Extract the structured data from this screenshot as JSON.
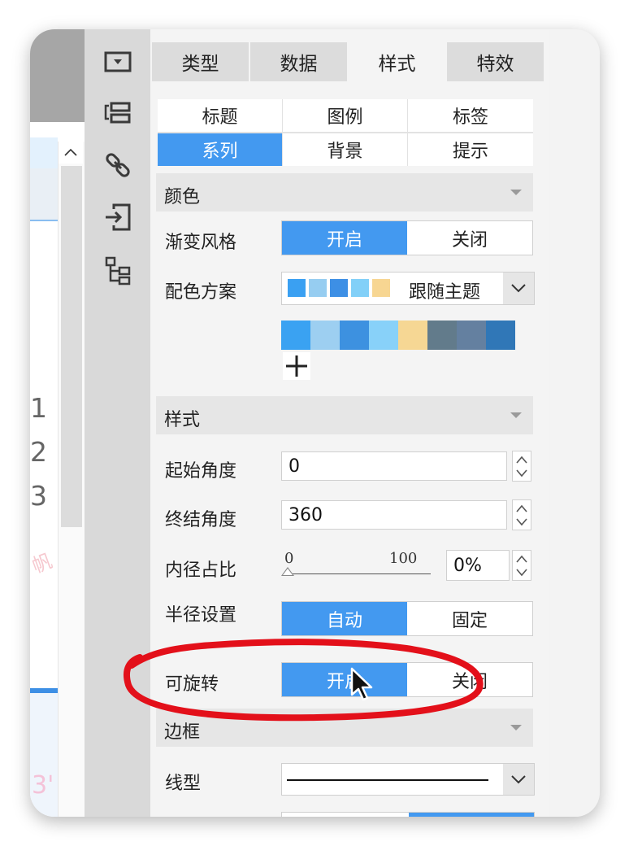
{
  "canvas": {
    "row_numbers": [
      "1",
      "2",
      "3"
    ],
    "ghost_text_1": "帆",
    "ghost_text_2": "3'"
  },
  "toolbar_icons": [
    "screen-icon",
    "layers-icon",
    "link-icon",
    "import-icon",
    "tree-icon"
  ],
  "tabs": [
    {
      "label": "类型",
      "active": false
    },
    {
      "label": "数据",
      "active": false
    },
    {
      "label": "样式",
      "active": true
    },
    {
      "label": "特效",
      "active": false
    }
  ],
  "subtabs": [
    {
      "label": "标题",
      "active": false
    },
    {
      "label": "图例",
      "active": false
    },
    {
      "label": "标签",
      "active": false
    },
    {
      "label": "系列",
      "active": true
    },
    {
      "label": "背景",
      "active": false
    },
    {
      "label": "提示",
      "active": false
    }
  ],
  "color_section": {
    "title": "颜色",
    "gradient": {
      "label": "渐变风格",
      "on_label": "开启",
      "off_label": "关闭",
      "selected": "开启"
    },
    "scheme": {
      "label": "配色方案",
      "value": "跟随主题",
      "preview_colors": [
        "#3aa0f2",
        "#96cdf1",
        "#3d8fe5",
        "#82d0f8",
        "#f7d692"
      ]
    },
    "palette": [
      "#3aa2f2",
      "#9dcff1",
      "#3d91e0",
      "#88d1f9",
      "#f6d794",
      "#627b8b",
      "#6480a0",
      "#3077b7"
    ],
    "add_label": "+"
  },
  "style_section": {
    "title": "样式",
    "start_angle": {
      "label": "起始角度",
      "value": "0"
    },
    "end_angle": {
      "label": "终结角度",
      "value": "360"
    },
    "inner_ratio": {
      "label": "内径占比",
      "min": "0",
      "max": "100",
      "value": "0%",
      "level": 0
    },
    "radius": {
      "label": "半径设置",
      "auto_label": "自动",
      "fixed_label": "固定",
      "selected": "自动"
    },
    "rotatable": {
      "label": "可旋转",
      "on_label": "开启",
      "off_label": "关闭",
      "selected": "开启"
    }
  },
  "border_section": {
    "title": "边框",
    "line_type": {
      "label": "线型",
      "value": "solid"
    }
  },
  "accent_color": "#4399f0",
  "annotation_color": "#e3101a"
}
